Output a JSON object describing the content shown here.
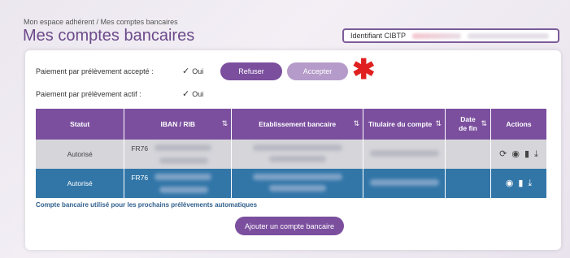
{
  "breadcrumb": "Mon espace adhérent / Mes comptes bancaires",
  "page_title": "Mes comptes bancaires",
  "cibtp": {
    "label": "Identifiant CIBTP"
  },
  "prelevement": {
    "accepte_label": "Paiement par prélèvement accepté :",
    "accepte_value": "Oui",
    "actif_label": "Paiement par prélèvement actif :",
    "actif_value": "Oui",
    "refuser_label": "Refuser",
    "accepter_label": "Accepter"
  },
  "table": {
    "headers": [
      "Statut",
      "IBAN / RIB",
      "Etablissement bancaire",
      "Titulaire du compte",
      "Date de fin",
      "Actions"
    ],
    "rows": [
      {
        "statut": "Autorisé",
        "iban_prefix": "FR76"
      },
      {
        "statut": "Autorisé",
        "iban_prefix": "FR76"
      }
    ]
  },
  "footer_note": "Compte bancaire utilisé pour les prochains prélèvements automatiques",
  "add_button_label": "Ajouter un compte bancaire",
  "colors": {
    "accent": "#7b4f9e",
    "selected_row": "#3276a8",
    "asterisk": "#e02020"
  }
}
